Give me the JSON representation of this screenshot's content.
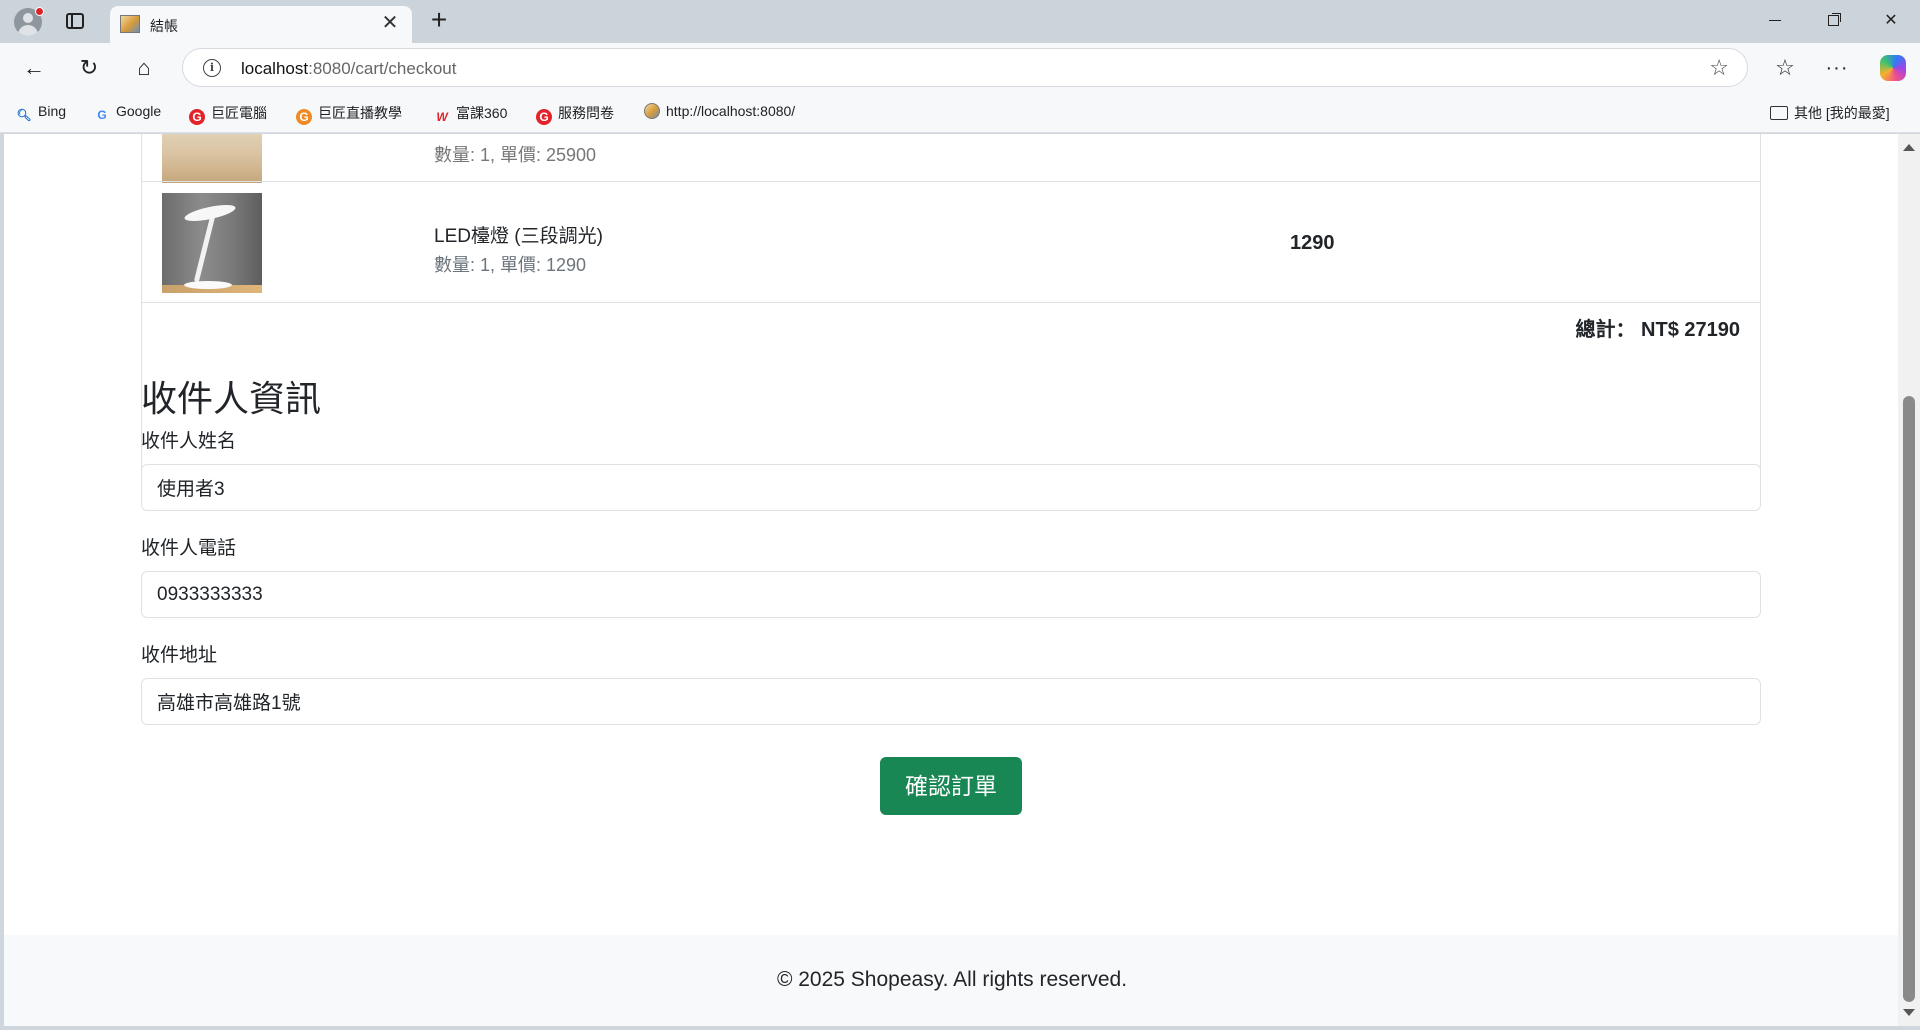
{
  "browser": {
    "tab_title": "結帳",
    "tab_close": "✕",
    "new_tab": "+",
    "url_host": "localhost",
    "url_rest": ":8080/cart/checkout",
    "more_icon": "···",
    "bookmarks": [
      "Bing",
      "Google",
      "巨匠電腦",
      "巨匠直播教學",
      "富課360",
      "服務問卷",
      "http://localhost:8080/"
    ],
    "bookmark_folder": "其他 [我的最愛]"
  },
  "cart": {
    "cut_item_sub": "數量: 1, 單價: 25900",
    "item": {
      "name": "LED檯燈 (三段調光)",
      "sub": "數量: 1, 單價: 1290",
      "price": "1290"
    },
    "total": "總計： NT$ 27190"
  },
  "recipient": {
    "section_title": "收件人資訊",
    "name_label": "收件人姓名",
    "name_value": "使用者3",
    "phone_label": "收件人電話",
    "phone_value": "0933333333",
    "address_label": "收件地址",
    "address_value": "高雄市高雄路1號",
    "confirm_button": "確認訂單"
  },
  "footer": {
    "text": "© 2025 Shopeasy. All rights reserved."
  },
  "colors": {
    "confirm_button": "#198754",
    "border": "#dee2e6",
    "footer_bg": "#f8f9fa"
  }
}
